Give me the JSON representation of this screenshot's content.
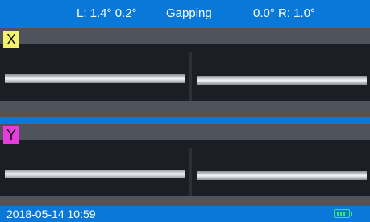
{
  "status": {
    "left_angle": "L: 1.4°  0.2°",
    "mode": "Gapping",
    "right_angle": "0.0°  R: 1.0°"
  },
  "views": {
    "x": {
      "label": "X",
      "label_color": "#f4f26a"
    },
    "y": {
      "label": "Y",
      "label_color": "#e83be0"
    }
  },
  "footer": {
    "datetime": "2018-05-14  10:59",
    "battery_icon": "battery-icon"
  },
  "colors": {
    "accent": "#0a78d8",
    "battery": "#3de96a"
  }
}
